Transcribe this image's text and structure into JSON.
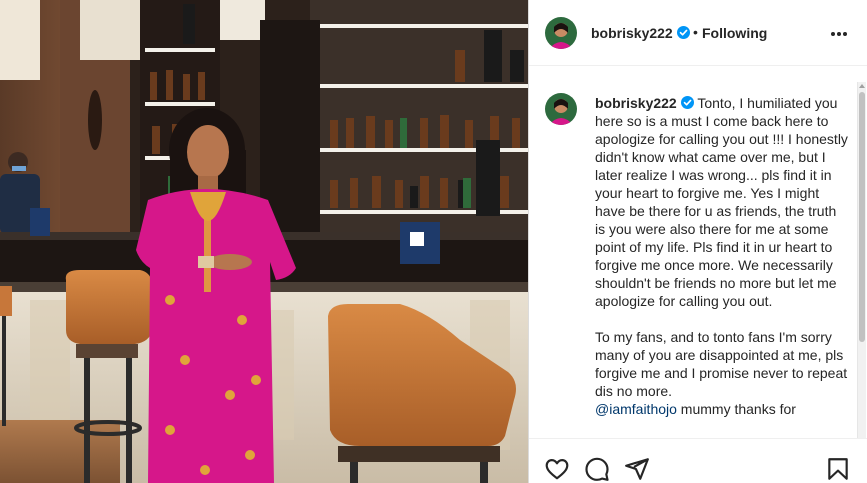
{
  "post": {
    "username": "bobrisky222",
    "separator": "•",
    "follow_status": "Following",
    "more_icon": "more-horizontal-icon",
    "verified_icon": "verified-badge-icon",
    "colors": {
      "verified": "#0095f6",
      "text": "#262626",
      "mention": "#00376b",
      "dress": "#d6178a",
      "stool": "#c7773a"
    }
  },
  "caption": {
    "username": "bobrisky222",
    "paragraph1": "Tonto, I humiliated you here so is a must I come back here to apologize for calling you out !!! I honestly didn't know what came over me, but I later realize I was wrong... pls find it in your heart to forgive me. Yes I might have be there for u as friends, the truth is you were also there for me at some point of my life. Pls find it in ur heart to forgive me once more. We necessarily shouldn't be friends no more but let me apologize for calling you out.",
    "paragraph2": "To my fans, and to tonto fans I'm sorry many of you are disappointed at me, pls forgive me and I promise never to repeat dis no more.",
    "mention": "@iamfaithojo",
    "mention_rest": " mummy thanks for"
  },
  "actions": {
    "like_icon": "heart-icon",
    "comment_icon": "comment-icon",
    "share_icon": "share-icon",
    "save_icon": "bookmark-icon"
  }
}
